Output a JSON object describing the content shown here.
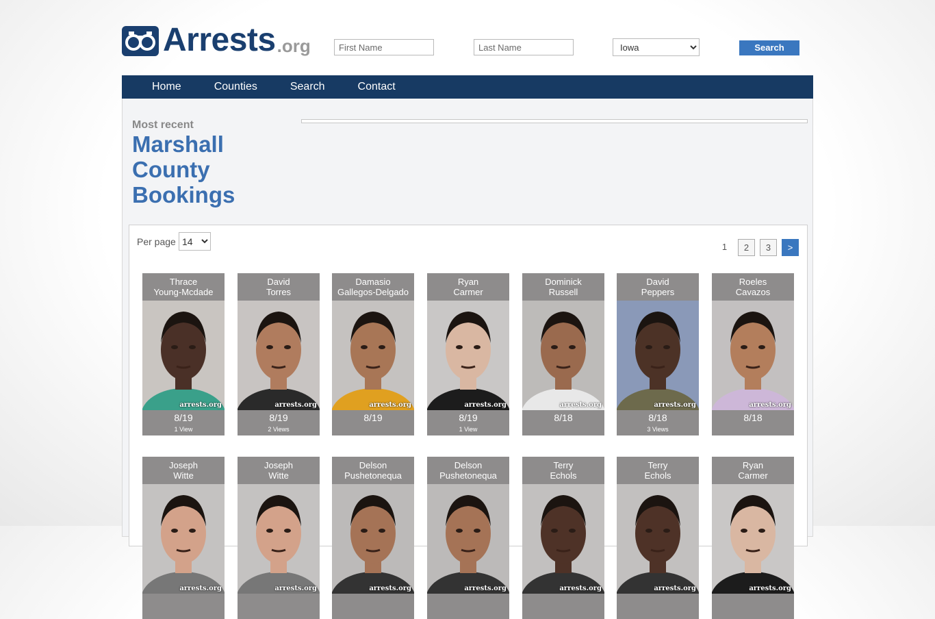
{
  "brand": {
    "name": "Arrests",
    "tld": ".org",
    "logo_color": "#1a3f6f"
  },
  "search": {
    "first_placeholder": "First Name",
    "last_placeholder": "Last Name",
    "state_selected": "Iowa",
    "button_label": "Search"
  },
  "nav": {
    "items": [
      "Home",
      "Counties",
      "Search",
      "Contact"
    ]
  },
  "page": {
    "kicker": "Most recent",
    "title": "Marshall County Bookings"
  },
  "listing": {
    "per_page_label": "Per page",
    "per_page_value": "14",
    "pagination": {
      "current": "1",
      "pages": [
        "2",
        "3"
      ],
      "next": ">"
    },
    "watermark": "arrests.org",
    "rows": [
      [
        {
          "first": "Thrace",
          "last": "Young-Mcdade",
          "date": "8/19",
          "views": "1 View",
          "skin": "#4a3027",
          "bg": "#c9c5c1",
          "shirt": "#3aa08a"
        },
        {
          "first": "David",
          "last": "Torres",
          "date": "8/19",
          "views": "2 Views",
          "skin": "#b07c5e",
          "bg": "#c8c4c2",
          "shirt": "#2a2a2a"
        },
        {
          "first": "Damasio",
          "last": "Gallegos-Delgado",
          "date": "8/19",
          "views": "",
          "skin": "#a87656",
          "bg": "#c5c2c0",
          "shirt": "#e0a020"
        },
        {
          "first": "Ryan",
          "last": "Carmer",
          "date": "8/19",
          "views": "1 View",
          "skin": "#d9b7a2",
          "bg": "#c9c7c6",
          "shirt": "#1c1c1c"
        },
        {
          "first": "Dominick",
          "last": "Russell",
          "date": "8/18",
          "views": "",
          "skin": "#9a6a4e",
          "bg": "#bdbbb9",
          "shirt": "#e8e8e8"
        },
        {
          "first": "David",
          "last": "Peppers",
          "date": "8/18",
          "views": "3 Views",
          "skin": "#4c3226",
          "bg": "#8a99b8",
          "shirt": "#6d6a4c"
        },
        {
          "first": "Roeles",
          "last": "Cavazos",
          "date": "8/18",
          "views": "",
          "skin": "#b37e5c",
          "bg": "#c3c0c0",
          "shirt": "#cdb7d8"
        }
      ],
      [
        {
          "first": "Joseph",
          "last": "Witte",
          "date": "",
          "views": "",
          "skin": "#d3a28a",
          "bg": "#c4c2c1",
          "shirt": "#777"
        },
        {
          "first": "Joseph",
          "last": "Witte",
          "date": "",
          "views": "",
          "skin": "#d3a28a",
          "bg": "#c4c2c1",
          "shirt": "#777"
        },
        {
          "first": "Delson",
          "last": "Pushetonequa",
          "date": "",
          "views": "",
          "skin": "#a57356",
          "bg": "#bcbab9",
          "shirt": "#333"
        },
        {
          "first": "Delson",
          "last": "Pushetonequa",
          "date": "",
          "views": "",
          "skin": "#a57356",
          "bg": "#bcbab9",
          "shirt": "#333"
        },
        {
          "first": "Terry",
          "last": "Echols",
          "date": "",
          "views": "",
          "skin": "#4e3227",
          "bg": "#c2c0bf",
          "shirt": "#333"
        },
        {
          "first": "Terry",
          "last": "Echols",
          "date": "",
          "views": "",
          "skin": "#4e3227",
          "bg": "#c2c0bf",
          "shirt": "#333"
        },
        {
          "first": "Ryan",
          "last": "Carmer",
          "date": "",
          "views": "",
          "skin": "#d9b7a2",
          "bg": "#c9c7c6",
          "shirt": "#1c1c1c"
        }
      ]
    ]
  }
}
